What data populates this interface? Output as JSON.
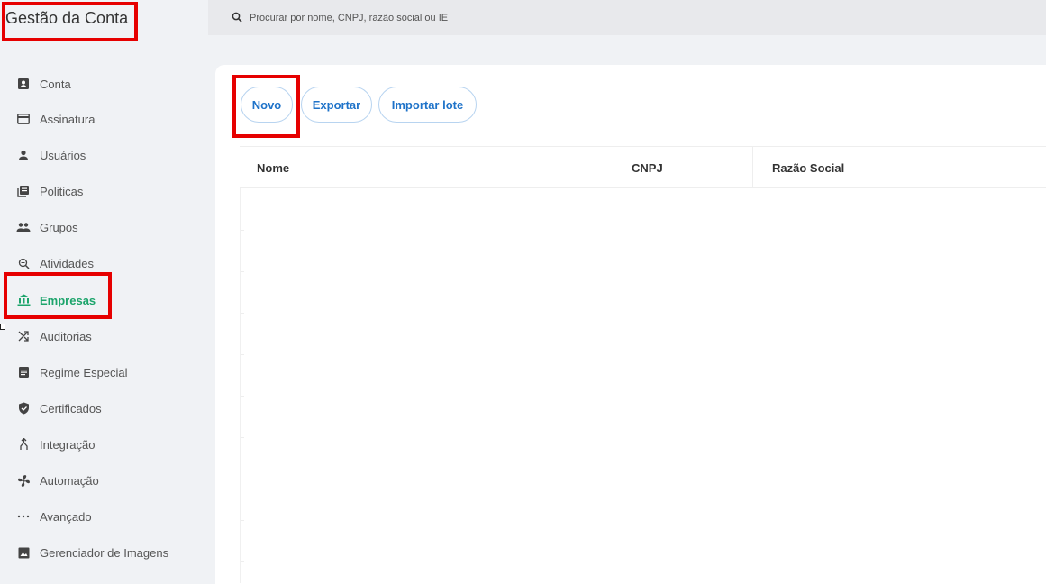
{
  "app": {
    "title": "Gestão da Conta"
  },
  "search": {
    "placeholder": "Procurar por nome, CNPJ, razão social ou IE"
  },
  "sidebar": {
    "active_color": "#1ca46b",
    "items": [
      {
        "label": "Conta",
        "icon": "account-box-icon"
      },
      {
        "label": "Assinatura",
        "icon": "credit-card-icon"
      },
      {
        "label": "Usuários",
        "icon": "user-icon"
      },
      {
        "label": "Politicas",
        "icon": "policy-document-icon"
      },
      {
        "label": "Grupos",
        "icon": "group-icon"
      },
      {
        "label": "Atividades",
        "icon": "magnifier-icon"
      },
      {
        "label": "Empresas",
        "icon": "bank-icon",
        "active": true
      },
      {
        "label": "Auditorias",
        "icon": "shuffle-icon"
      },
      {
        "label": "Regime Especial",
        "icon": "document-icon"
      },
      {
        "label": "Certificados",
        "icon": "shield-icon"
      },
      {
        "label": "Integração",
        "icon": "merge-icon"
      },
      {
        "label": "Automação",
        "icon": "fan-icon"
      },
      {
        "label": "Avançado",
        "icon": "more-horizontal-icon"
      },
      {
        "label": "Gerenciador de Imagens",
        "icon": "image-icon"
      }
    ]
  },
  "toolbar": {
    "new_label": "Novo",
    "export_label": "Exportar",
    "import_label": "Importar lote",
    "button_color": "#1f73c9"
  },
  "table": {
    "columns": [
      "Nome",
      "CNPJ",
      "Razão Social"
    ],
    "rows": []
  },
  "annotation_color": "#e60000"
}
